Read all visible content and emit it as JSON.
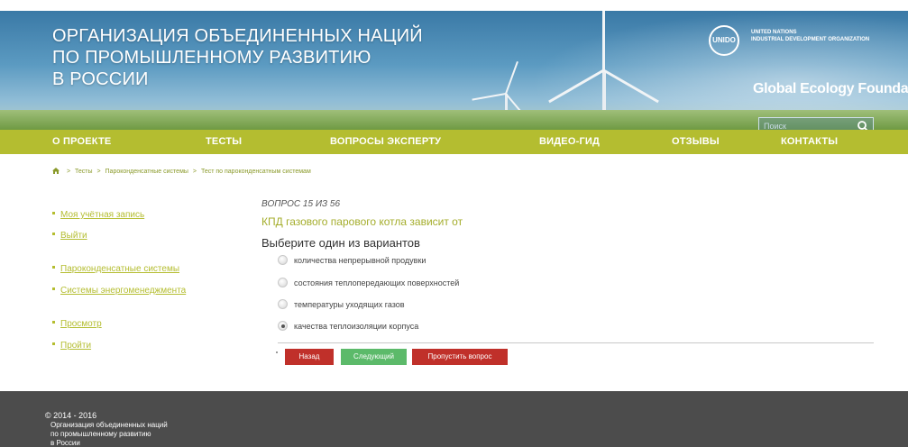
{
  "header": {
    "title_lines": [
      "ОРГАНИЗАЦИЯ ОБЪЕДИНЕННЫХ НАЦИЙ",
      "ПО ПРОМЫШЛЕННОМУ РАЗВИТИЮ",
      "В РОССИИ"
    ],
    "unido_logo_text": "UNIDO",
    "unido_lines": [
      "UNITED NATIONS",
      "INDUSTRIAL DEVELOPMENT ORGANIZATION"
    ],
    "gef_name": "Global Ecology Foundation",
    "search_placeholder": "Поиск"
  },
  "nav": {
    "items": [
      "О ПРОЕКТЕ",
      "ТЕСТЫ",
      "ВОПРОСЫ ЭКСПЕРТУ",
      "ВИДЕО-ГИД",
      "ОТЗЫВЫ",
      "КОНТАКТЫ"
    ],
    "bg_color": "#b4bd30"
  },
  "breadcrumb": {
    "items": [
      "Тесты",
      "Пароконденсатные системы",
      "Тест по пароконденсатным системам"
    ],
    "separator": ">"
  },
  "sidebar": {
    "items": [
      "Моя учётная запись",
      "Выйти",
      "Пароконденсатные системы",
      "Системы энергоменеджмента",
      "Просмотр",
      "Пройти"
    ]
  },
  "quiz": {
    "counter": "ВОПРОС 15 ИЗ 56",
    "question": "КПД газового парового котла зависит от",
    "prompt": "Выберите один из вариантов",
    "options": [
      {
        "label": "количества непрерывной продувки",
        "checked": false
      },
      {
        "label": "состояния теплопередающих поверхностей",
        "checked": false
      },
      {
        "label": "температуры уходящих газов",
        "checked": false
      },
      {
        "label": "качества теплоизоляции корпуса",
        "checked": true
      }
    ],
    "buttons": {
      "back": "Назад",
      "next": "Следующий",
      "skip": "Пропустить вопрос"
    }
  },
  "footer": {
    "copyright": "© 2014 - 2016",
    "org_lines": [
      "Организация объединенных наций",
      "по промышленному развитию",
      "в России"
    ]
  }
}
